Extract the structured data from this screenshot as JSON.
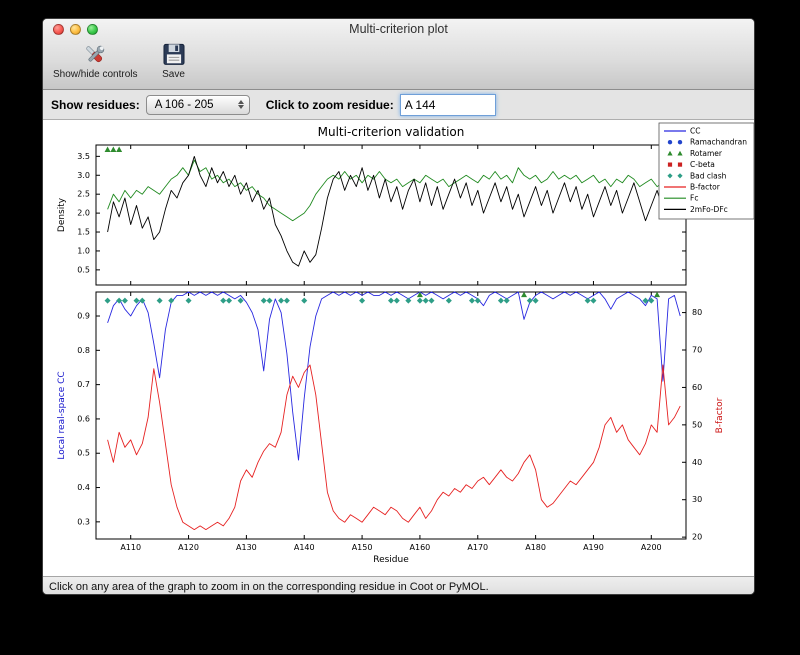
{
  "window": {
    "title": "Multi-criterion plot"
  },
  "toolbar": {
    "show_hide_label": "Show/hide controls",
    "save_label": "Save"
  },
  "controls": {
    "show_residues_label": "Show residues:",
    "residue_range_value": "A 106 - 205",
    "zoom_residue_label": "Click to zoom residue:",
    "zoom_residue_value": "A 144"
  },
  "status_bar": {
    "text": "Click on any area of the graph to zoom in on the corresponding residue in Coot or PyMOL."
  },
  "chart_data": {
    "type": "line",
    "title": "Multi-criterion validation",
    "xlabel": "Residue",
    "x_start": 106,
    "x_end": 205,
    "xlim": [
      104,
      206
    ],
    "x_tick_prefix": "A",
    "x_ticks": [
      110,
      120,
      130,
      140,
      150,
      160,
      170,
      180,
      190,
      200
    ],
    "top": {
      "ylabel": "Density",
      "ylim": [
        0.1,
        3.8
      ],
      "y_ticks": [
        0.5,
        1.0,
        1.5,
        2.0,
        2.5,
        3.0,
        3.5
      ],
      "series": [
        {
          "name": "Fc",
          "color": "#228b22",
          "values": [
            2.1,
            2.5,
            2.3,
            2.6,
            2.4,
            2.6,
            2.5,
            2.7,
            2.6,
            2.5,
            2.7,
            2.9,
            3.0,
            3.2,
            3.0,
            3.4,
            3.1,
            3.2,
            2.9,
            3.0,
            2.8,
            2.9,
            2.7,
            2.8,
            2.6,
            2.7,
            2.5,
            2.4,
            2.2,
            2.1,
            2.0,
            1.9,
            1.8,
            1.9,
            2.0,
            2.2,
            2.5,
            2.7,
            2.9,
            3.0,
            2.9,
            3.1,
            2.9,
            3.0,
            2.8,
            3.0,
            2.9,
            3.1,
            2.9,
            2.8,
            2.9,
            2.7,
            2.8,
            2.9,
            2.8,
            3.0,
            2.9,
            2.8,
            2.9,
            2.7,
            2.8,
            2.9,
            3.0,
            2.9,
            2.8,
            3.0,
            2.9,
            3.1,
            2.9,
            3.0,
            2.8,
            3.2,
            3.0,
            2.9,
            3.0,
            2.8,
            2.9,
            3.1,
            2.9,
            3.0,
            2.9,
            3.0,
            2.8,
            2.9,
            3.0,
            2.8,
            2.9,
            2.7,
            2.9,
            2.8,
            3.0,
            2.9,
            2.7,
            2.8,
            2.9,
            2.7,
            2.8,
            2.6,
            2.8,
            2.7
          ]
        },
        {
          "name": "2mFo-DFc",
          "color": "#000000",
          "values": [
            1.5,
            2.3,
            1.9,
            2.4,
            1.7,
            2.2,
            1.6,
            1.9,
            1.3,
            1.5,
            2.1,
            2.6,
            2.4,
            2.8,
            3.0,
            3.5,
            3.0,
            2.7,
            3.2,
            2.8,
            3.1,
            2.7,
            3.0,
            2.5,
            2.8,
            2.3,
            2.6,
            2.1,
            2.4,
            1.7,
            1.4,
            1.0,
            0.7,
            0.6,
            1.0,
            0.7,
            0.9,
            1.6,
            2.4,
            2.9,
            3.1,
            2.6,
            3.0,
            2.7,
            3.2,
            2.6,
            3.0,
            2.4,
            2.9,
            2.3,
            2.7,
            2.1,
            2.6,
            2.9,
            2.3,
            2.8,
            2.2,
            2.7,
            2.1,
            2.5,
            2.9,
            2.4,
            2.8,
            2.2,
            2.6,
            2.0,
            2.4,
            2.8,
            2.3,
            2.7,
            2.1,
            2.5,
            1.9,
            2.3,
            2.7,
            2.2,
            2.6,
            2.0,
            2.4,
            2.8,
            2.3,
            2.7,
            2.1,
            2.5,
            1.9,
            2.3,
            2.7,
            2.2,
            2.6,
            2.0,
            2.4,
            2.8,
            2.3,
            1.8,
            2.2,
            2.6,
            2.1,
            2.5,
            2.3,
            2.4
          ]
        }
      ],
      "markers": [
        {
          "name": "Rotamer",
          "shape": "triangle",
          "color": "#2e8b2e",
          "y": 3.68,
          "residues": [
            106,
            107,
            108
          ]
        }
      ]
    },
    "bottom": {
      "ylabel_left": "Local real-space CC",
      "ylabel_left_color": "#1414cc",
      "ylim_left": [
        0.25,
        0.97
      ],
      "y_ticks_left": [
        0.3,
        0.4,
        0.5,
        0.6,
        0.7,
        0.8,
        0.9
      ],
      "ylabel_right": "B-factor",
      "ylabel_right_color": "#cc1414",
      "ylim_right": [
        19.5,
        85.5
      ],
      "y_ticks_right": [
        20,
        30,
        40,
        50,
        60,
        70,
        80
      ],
      "series": [
        {
          "name": "CC",
          "color": "#2929e0",
          "axis": "left",
          "values": [
            0.88,
            0.93,
            0.95,
            0.92,
            0.9,
            0.93,
            0.95,
            0.91,
            0.82,
            0.72,
            0.86,
            0.94,
            0.96,
            0.96,
            0.97,
            0.96,
            0.97,
            0.96,
            0.97,
            0.96,
            0.97,
            0.96,
            0.95,
            0.96,
            0.94,
            0.91,
            0.86,
            0.74,
            0.89,
            0.95,
            0.91,
            0.79,
            0.62,
            0.48,
            0.66,
            0.81,
            0.9,
            0.95,
            0.96,
            0.97,
            0.96,
            0.97,
            0.96,
            0.97,
            0.96,
            0.97,
            0.96,
            0.96,
            0.97,
            0.96,
            0.97,
            0.96,
            0.95,
            0.96,
            0.97,
            0.96,
            0.97,
            0.96,
            0.95,
            0.96,
            0.97,
            0.96,
            0.97,
            0.96,
            0.95,
            0.93,
            0.96,
            0.97,
            0.96,
            0.95,
            0.96,
            0.97,
            0.89,
            0.94,
            0.96,
            0.97,
            0.96,
            0.95,
            0.96,
            0.97,
            0.96,
            0.97,
            0.96,
            0.95,
            0.96,
            0.97,
            0.95,
            0.92,
            0.95,
            0.96,
            0.97,
            0.96,
            0.95,
            0.93,
            0.96,
            0.95,
            0.71,
            0.95,
            0.96,
            0.9
          ]
        },
        {
          "name": "B-factor",
          "color": "#e62222",
          "axis": "right",
          "values": [
            46,
            40,
            48,
            44,
            46,
            42,
            45,
            52,
            65,
            56,
            45,
            34,
            28,
            24,
            23,
            22,
            23,
            22,
            23,
            24,
            23,
            25,
            28,
            35,
            38,
            36,
            40,
            43,
            45,
            44,
            48,
            58,
            63,
            60,
            64,
            66,
            58,
            45,
            32,
            27,
            25,
            24,
            26,
            25,
            24,
            26,
            28,
            27,
            26,
            28,
            27,
            25,
            24,
            26,
            28,
            25,
            27,
            30,
            32,
            31,
            33,
            32,
            34,
            33,
            35,
            36,
            34,
            36,
            38,
            36,
            35,
            37,
            40,
            42,
            38,
            30,
            28,
            29,
            31,
            33,
            35,
            34,
            36,
            38,
            40,
            44,
            50,
            52,
            48,
            50,
            46,
            44,
            42,
            45,
            50,
            48,
            66,
            50,
            52,
            55
          ]
        }
      ],
      "markers": [
        {
          "name": "Bad clash",
          "shape": "diamond",
          "color": "#2e9e87",
          "y": 0.945,
          "residues": [
            106,
            108,
            109,
            111,
            112,
            115,
            117,
            120,
            126,
            127,
            129,
            133,
            134,
            136,
            137,
            140,
            150,
            155,
            156,
            158,
            160,
            161,
            162,
            165,
            169,
            170,
            174,
            175,
            179,
            180,
            189,
            190,
            199,
            200
          ]
        },
        {
          "name": "Rotamer",
          "shape": "triangle",
          "color": "#2e8b2e",
          "y": 0.962,
          "residues": [
            160,
            178,
            201
          ]
        }
      ]
    },
    "legend": [
      {
        "label": "CC",
        "type": "line",
        "color": "#2929e0"
      },
      {
        "label": "Ramachandran",
        "type": "markers",
        "shape": "circle",
        "color": "#2244cc"
      },
      {
        "label": "Rotamer",
        "type": "markers",
        "shape": "triangle",
        "color": "#2e8b2e"
      },
      {
        "label": "C-beta",
        "type": "markers",
        "shape": "square",
        "color": "#cc2222"
      },
      {
        "label": "Bad clash",
        "type": "markers",
        "shape": "diamond",
        "color": "#2e9e87"
      },
      {
        "label": "B-factor",
        "type": "line",
        "color": "#e62222"
      },
      {
        "label": "Fc",
        "type": "line",
        "color": "#228b22"
      },
      {
        "label": "2mFo-DFc",
        "type": "line",
        "color": "#000000"
      }
    ]
  }
}
